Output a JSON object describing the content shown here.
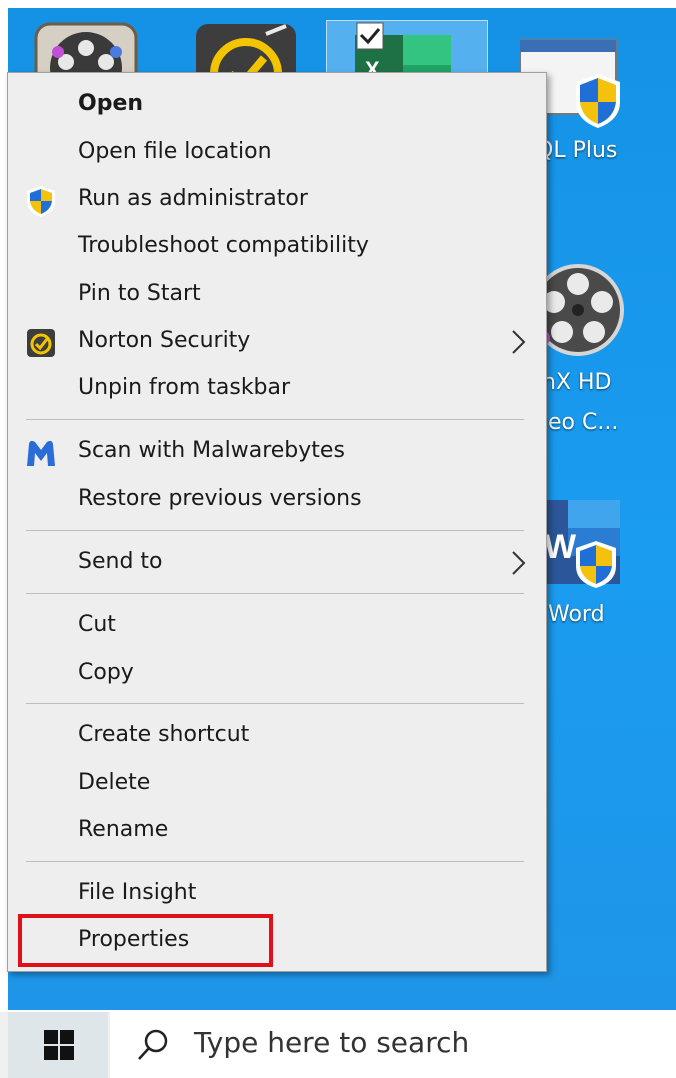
{
  "desktop": {
    "icons": [
      {
        "label": "QL Plus"
      },
      {
        "label": "nX HD"
      },
      {
        "label": "eo C..."
      },
      {
        "label": "Word"
      }
    ]
  },
  "context_menu": {
    "items": [
      {
        "label": "Open",
        "bold": true
      },
      {
        "label": "Open file location"
      },
      {
        "label": "Run as administrator",
        "icon": "uac-shield-icon"
      },
      {
        "label": "Troubleshoot compatibility"
      },
      {
        "label": "Pin to Start"
      },
      {
        "label": "Norton Security",
        "icon": "norton-icon",
        "submenu": true
      },
      {
        "label": "Unpin from taskbar"
      },
      {
        "label": "Scan with Malwarebytes",
        "icon": "malwarebytes-icon"
      },
      {
        "label": "Restore previous versions"
      },
      {
        "label": "Send to",
        "submenu": true
      },
      {
        "label": "Cut"
      },
      {
        "label": "Copy"
      },
      {
        "label": "Create shortcut"
      },
      {
        "label": "Delete"
      },
      {
        "label": "Rename"
      },
      {
        "label": "File Insight"
      },
      {
        "label": "Properties",
        "highlighted": true
      }
    ]
  },
  "taskbar": {
    "start_icon": "windows-logo-icon",
    "search_icon": "search-icon",
    "search_placeholder": "Type here to search"
  },
  "colors": {
    "desktop_blue": "#1592e6",
    "menu_bg": "#eeeeee",
    "highlight_red": "#e0101a"
  }
}
